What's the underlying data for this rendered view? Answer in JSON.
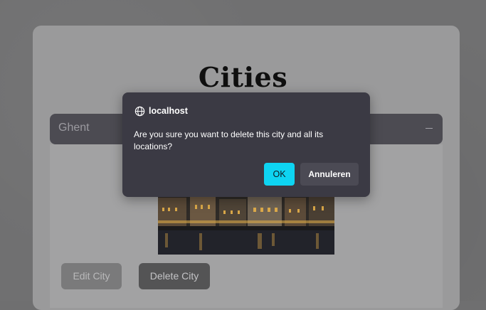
{
  "page": {
    "title": "Cities"
  },
  "accordion": {
    "city_name": "Ghent",
    "collapse_icon": "minus-icon"
  },
  "city_card": {
    "image_description_icon": "city-photo",
    "edit_label": "Edit City",
    "delete_label": "Delete City"
  },
  "dialog": {
    "origin": "localhost",
    "origin_icon": "globe-icon",
    "message": "Are you sure you want to delete this city and all its locations?",
    "ok_label": "OK",
    "cancel_label": "Annuleren"
  },
  "colors": {
    "dialog_bg": "#3b3a44",
    "ok_accent": "#0ed4f2",
    "accordion_header": "#4c4b52"
  }
}
